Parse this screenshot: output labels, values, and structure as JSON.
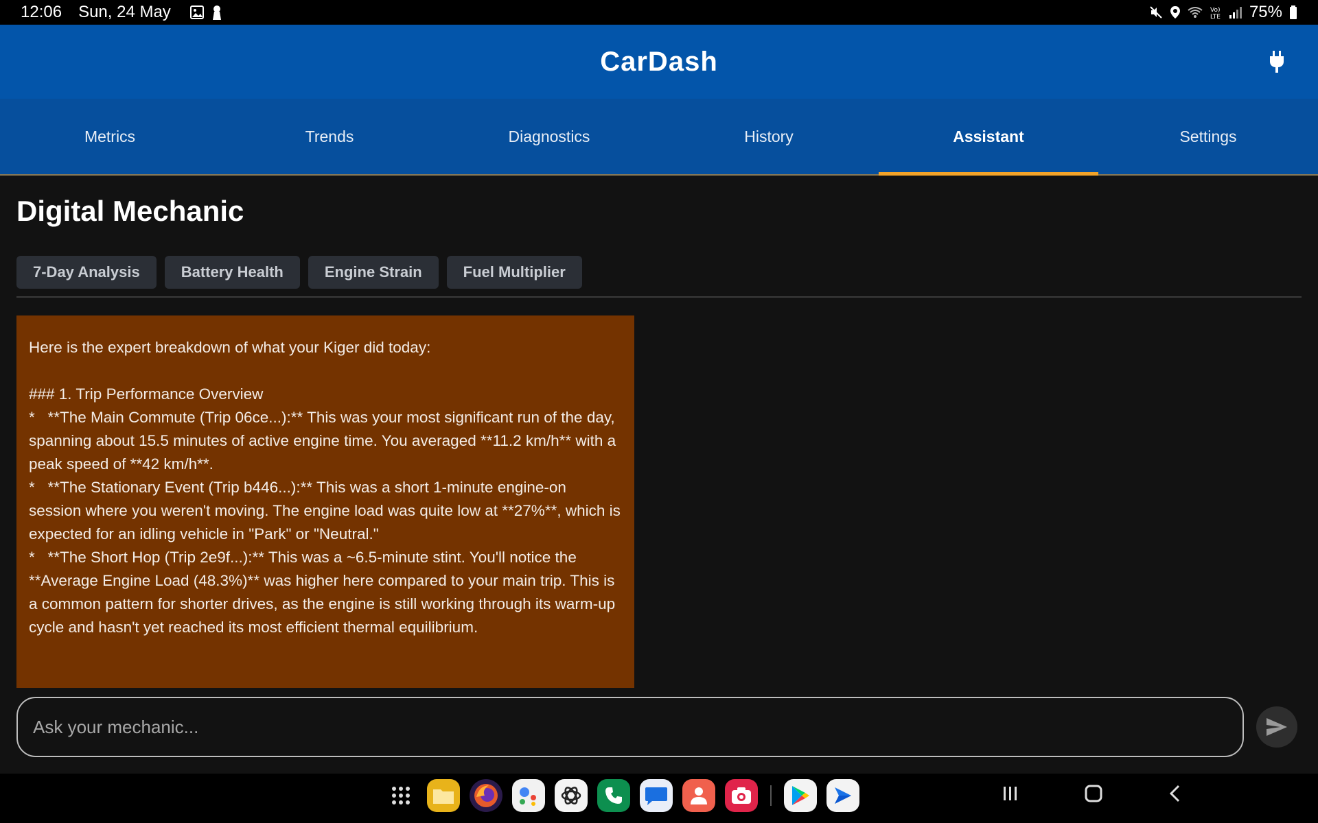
{
  "status_bar": {
    "time": "12:06",
    "date": "Sun, 24 May",
    "battery": "75%",
    "icons_left": [
      "image-icon",
      "keyhole-icon"
    ],
    "icons_right": [
      "mute-icon",
      "location-icon",
      "wifi-icon",
      "volte-icon",
      "signal-icon",
      "battery-icon"
    ]
  },
  "app_bar": {
    "title": "CarDash",
    "action_icon": "plug-icon"
  },
  "tabs": [
    {
      "label": "Metrics",
      "active": false
    },
    {
      "label": "Trends",
      "active": false
    },
    {
      "label": "Diagnostics",
      "active": false
    },
    {
      "label": "History",
      "active": false
    },
    {
      "label": "Assistant",
      "active": true
    },
    {
      "label": "Settings",
      "active": false
    }
  ],
  "colors": {
    "app_bar": "#0355AA",
    "tab_bar": "#064F9D",
    "tab_indicator": "#F2A329",
    "message_bg": "#743300",
    "chip_bg": "#2b2f36"
  },
  "page": {
    "title": "Digital Mechanic"
  },
  "chips": [
    "7-Day Analysis",
    "Battery Health",
    "Engine Strain",
    "Fuel Multiplier"
  ],
  "message": {
    "text": "Here is the expert breakdown of what your Kiger did today:\n\n### 1. Trip Performance Overview\n*   **The Main Commute (Trip 06ce...):** This was your most significant run of the day, spanning about 15.5 minutes of active engine time. You averaged **11.2 km/h** with a peak speed of **42 km/h**.\n*   **The Stationary Event (Trip b446...):** This was a short 1-minute engine-on session where you weren't moving. The engine load was quite low at **27%**, which is expected for an idling vehicle in \"Park\" or \"Neutral.\"\n*   **The Short Hop (Trip 2e9f...):** This was a ~6.5-minute stint. You'll notice the **Average Engine Load (48.3%)** was higher here compared to your main trip. This is a common pattern for shorter drives, as the engine is still working through its warm-up cycle and hasn't yet reached its most efficient thermal equilibrium."
  },
  "input": {
    "placeholder": "Ask your mechanic...",
    "value": ""
  },
  "send_button": {
    "icon": "send-icon"
  },
  "dock": {
    "apps": [
      "app-drawer-icon",
      "files-icon",
      "firefox-icon",
      "assistant-icon",
      "chatgpt-icon",
      "phone-icon",
      "messages-icon",
      "contacts-icon",
      "camera-icon",
      "play-store-icon",
      "play-games-icon"
    ]
  },
  "nav": {
    "buttons": [
      "recents-icon",
      "home-icon",
      "back-icon"
    ]
  }
}
